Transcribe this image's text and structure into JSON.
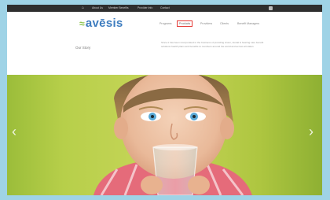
{
  "topbar": {
    "home_icon": "home-icon",
    "links": [
      "About Us",
      "Member Benefits",
      "Provider Info",
      "Contact"
    ],
    "login_icon": "user-icon"
  },
  "header": {
    "logo_text": "avēsis",
    "nav": [
      "Programs",
      "Products",
      "Providers",
      "Clients",
      "Benefit Managers"
    ],
    "active_nav_index": 1,
    "story_title": "Our Story",
    "story_text": "Since it has been incorporated in the business of providing vision, dental & hearing care benefit solutions health plans and benefits to members around the world and across all states."
  },
  "hero": {
    "prev_glyph": "‹",
    "next_glyph": "›",
    "dots": 4,
    "active_dot": 1
  },
  "colors": {
    "brand_blue": "#3d7cbf",
    "brand_green": "#8bc34a",
    "highlight_red": "#e53935",
    "page_bg": "#9fd3e6"
  }
}
